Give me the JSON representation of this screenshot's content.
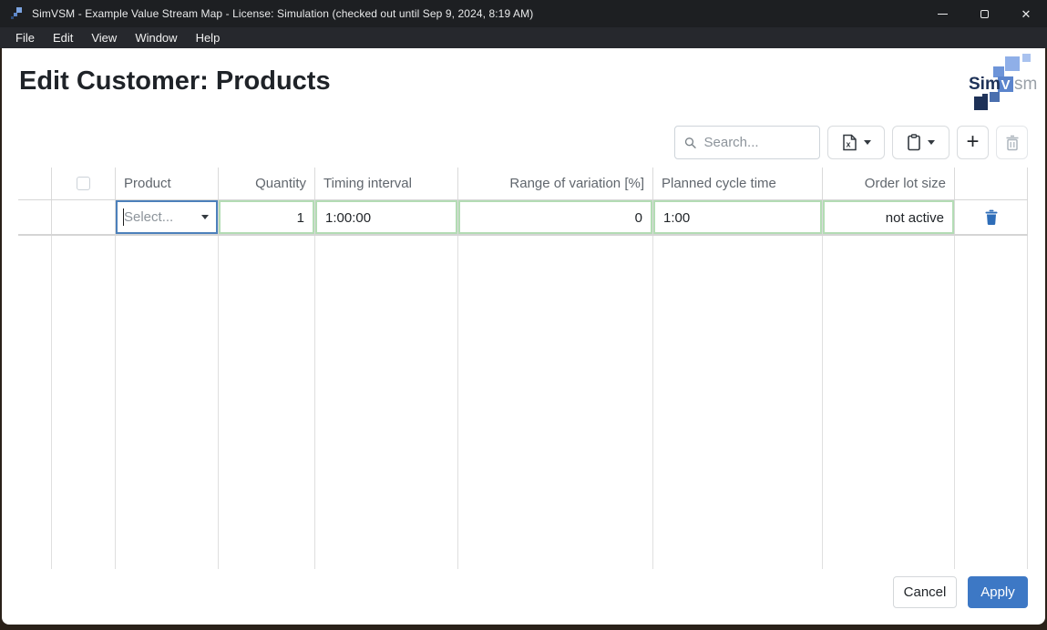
{
  "window": {
    "title": "SimVSM - Example Value Stream Map - License: Simulation (checked out until Sep 9, 2024, 8:19 AM)"
  },
  "menu": {
    "items": [
      {
        "label": "File"
      },
      {
        "label": "Edit"
      },
      {
        "label": "View"
      },
      {
        "label": "Window"
      },
      {
        "label": "Help"
      }
    ]
  },
  "page": {
    "title": "Edit Customer: Products"
  },
  "logo": {
    "sim": "Sim",
    "v": "V",
    "sm": "sm"
  },
  "toolbar": {
    "search": {
      "placeholder": "Search...",
      "value": ""
    },
    "icons": {
      "search": "magnifier-icon",
      "export": "excel-file-icon",
      "paste": "clipboard-icon",
      "add": "plus-icon",
      "delete": "trash-icon"
    }
  },
  "table": {
    "columns": [
      {
        "label": ""
      },
      {
        "label": ""
      },
      {
        "label": "Product"
      },
      {
        "label": "Quantity"
      },
      {
        "label": "Timing interval"
      },
      {
        "label": "Range of variation [%]"
      },
      {
        "label": "Planned cycle time"
      },
      {
        "label": "Order lot size"
      },
      {
        "label": ""
      }
    ],
    "row": {
      "product": {
        "placeholder": "Select..."
      },
      "quantity": "1",
      "timing_interval": "1:00:00",
      "range_of_variation": "0",
      "planned_cycle_time": "1:00",
      "order_lot_size": "not active"
    }
  },
  "footer": {
    "cancel_label": "Cancel",
    "apply_label": "Apply"
  },
  "colors": {
    "accent_blue": "#3d78c5",
    "edit_green_border": "#b3dcb4",
    "focus_blue_border": "#4c80bb",
    "row_trash_blue": "#2e6db8",
    "titlebar_bg": "#1d1f22",
    "menubar_bg": "#26282d"
  }
}
